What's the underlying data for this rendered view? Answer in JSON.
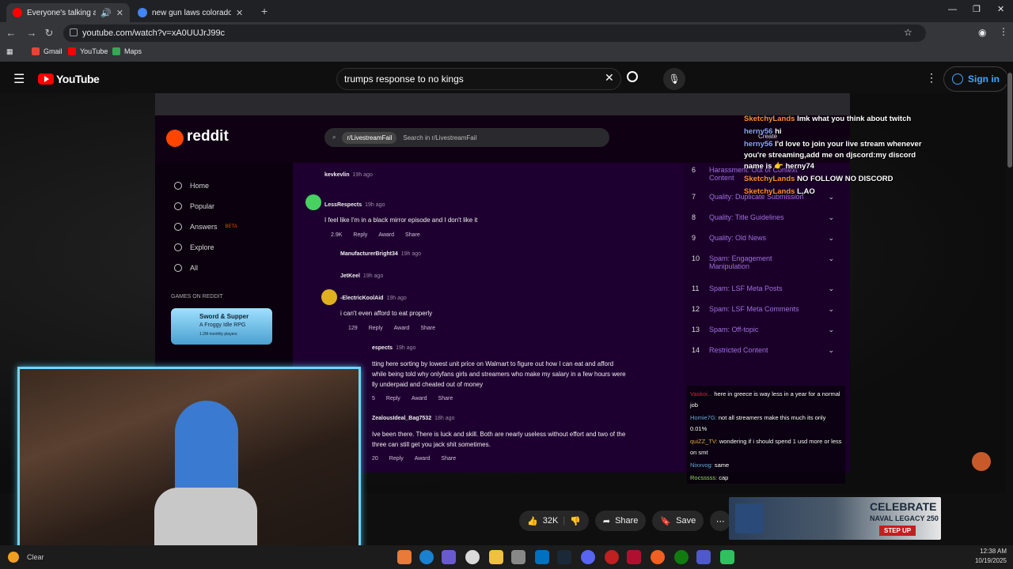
{
  "browser": {
    "tabs": [
      {
        "title": "Everyone's talking about th",
        "active": true,
        "color": "#ff0000"
      },
      {
        "title": "new gun laws colorado 2025 - G",
        "active": false,
        "color": "#4285f4"
      }
    ],
    "url": "youtube.com/watch?v=xA0UUJrJ99c",
    "bookmarks": [
      "Gmail",
      "YouTube",
      "Maps"
    ]
  },
  "youtube": {
    "logo": "YouTube",
    "search_value": "trumps response to no kings",
    "signin_label": "Sign in",
    "likes": "32K",
    "share_label": "Share",
    "save_label": "Save"
  },
  "reddit": {
    "logo": "reddit",
    "subreddit": "r/LivestreamFail",
    "search_placeholder": "Search in r/LivestreamFail",
    "create_label": "Create",
    "nav": [
      "Home",
      "Popular",
      "Answers",
      "Explore",
      "All"
    ],
    "beta": "BETA",
    "games_header": "GAMES ON REDDIT",
    "game": {
      "title": "Sword & Supper",
      "subtitle": "A Froggy Idle RPG",
      "players": "1.2M monthly players"
    },
    "comments": [
      {
        "user": "kevkevlin",
        "time": "19h ago"
      },
      {
        "user": "LessRespects",
        "time": "19h ago",
        "text": "I feel like I'm in a black mirror episode and I don't like it",
        "votes": "2.9K"
      },
      {
        "user": "ManufacturerBright34",
        "time": "19h ago"
      },
      {
        "user": "JetKeel",
        "time": "19h ago"
      },
      {
        "user": "-ElectricKoolAid",
        "time": "19h ago",
        "text": "i can't even afford to eat properly",
        "votes": "129"
      },
      {
        "user": "espects",
        "time": "19h ago",
        "text1": "tting here sorting by lowest unit price on Walmart to figure out how I can eat and afford",
        "text2": "while being told why onlyfans girls and streamers who make my salary in a few hours were",
        "text3": "lly underpaid and cheated out of money",
        "votes": "5"
      },
      {
        "user": "ZealousIdeal_Bag7532",
        "time": "18h ago",
        "text1": "Ive been there. There is luck and skill. Both are nearly useless without effort and two of the",
        "text2": "three can still get you jack shit sometimes.",
        "votes": "20"
      }
    ],
    "actions": {
      "reply": "Reply",
      "award": "Award",
      "share": "Share"
    },
    "rules": [
      {
        "num": "6",
        "label": "Harassment: Out of Context Content"
      },
      {
        "num": "7",
        "label": "Quality: Duplicate Submission"
      },
      {
        "num": "8",
        "label": "Quality: Title Guidelines"
      },
      {
        "num": "9",
        "label": "Quality: Old News"
      },
      {
        "num": "10",
        "label": "Spam: Engagement Manipulation"
      },
      {
        "num": "11",
        "label": "Spam: LSF Meta Posts"
      },
      {
        "num": "12",
        "label": "Spam: LSF Meta Comments"
      },
      {
        "num": "13",
        "label": "Spam: Off-topic"
      },
      {
        "num": "14",
        "label": "Restricted Content"
      }
    ]
  },
  "stream_chat": [
    {
      "user": "SketchyLands",
      "msg": "lmk what you think about twitch",
      "color": "#ff8c2e"
    },
    {
      "user": "herny56",
      "msg": "hi",
      "color": "#8aa2ff"
    },
    {
      "user": "herny56",
      "msg": "I'd love to join your live stream whenever you're streaming,add me on djscord:my discord name is 👉 herny74",
      "color": "#8aa2ff"
    },
    {
      "user": "SketchyLands",
      "msg": "NO FOLLOW NO DISCORD",
      "color": "#ff8c2e"
    },
    {
      "user": "SketchyLands",
      "msg": "L,AO",
      "color": "#ff8c2e"
    }
  ],
  "overlay_chat": [
    {
      "user": "Vaskoi...",
      "msg": "here in greece is way less in a year for a normal job",
      "color": "#d24"
    },
    {
      "user": "Homie7G:",
      "msg": "not all streamers make this much its only 0.01%",
      "color": "#6ad"
    },
    {
      "user": "quiZZ_TV:",
      "msg": "wondering if i should spend 1 usd more or less on smt",
      "color": "#da4"
    },
    {
      "user": "Nixxvog:",
      "msg": "same",
      "color": "#6ad"
    },
    {
      "user": "Rocsssss:",
      "msg": "cap",
      "color": "#9d6"
    }
  ],
  "ad": {
    "title": "CELEBRATE",
    "subtitle": "NAVAL LEGACY 250",
    "cta": "STEP UP"
  },
  "taskbar": {
    "weather": "Clear",
    "time": "12:38 AM",
    "date": "10/19/2025"
  }
}
